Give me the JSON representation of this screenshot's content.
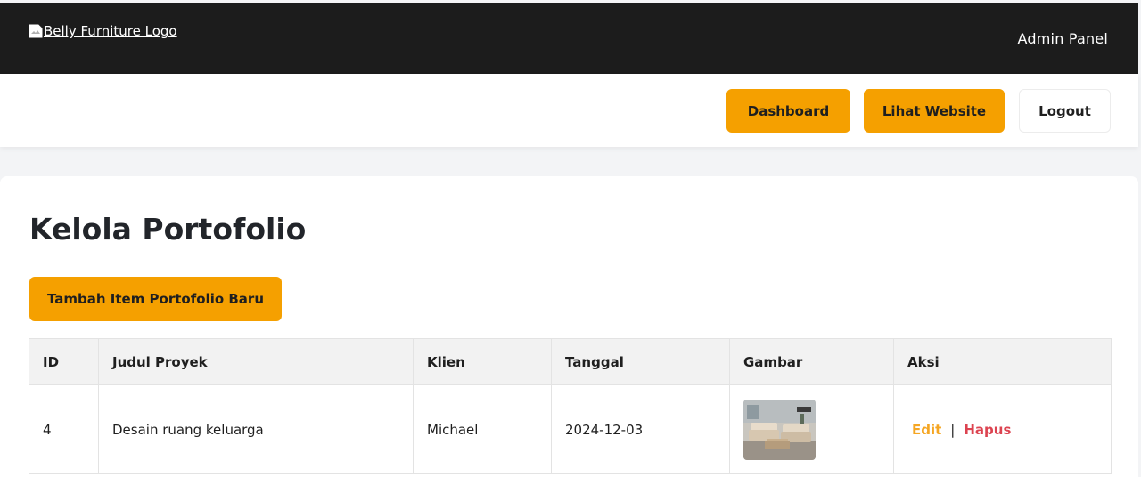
{
  "header": {
    "logo_alt": "Belly Furniture Logo",
    "title": "Admin Panel",
    "logo_icon": "broken-image-icon"
  },
  "nav": {
    "dashboard": "Dashboard",
    "website": "Lihat Website",
    "logout": "Logout"
  },
  "main": {
    "title": "Kelola Portofolio",
    "add_button": "Tambah Item Portofolio Baru"
  },
  "table": {
    "columns": [
      "ID",
      "Judul Proyek",
      "Klien",
      "Tanggal",
      "Gambar",
      "Aksi"
    ],
    "rows": [
      {
        "id": "4",
        "title": "Desain ruang keluarga",
        "client": "Michael",
        "date": "2024-12-03",
        "image": "living-room-thumbnail",
        "edit": "Edit",
        "separator": "|",
        "delete": "Hapus"
      }
    ]
  },
  "colors": {
    "accent": "#f5a000",
    "header_bg": "#1c1c1c",
    "edit": "#f5a623",
    "delete": "#dc4350"
  }
}
